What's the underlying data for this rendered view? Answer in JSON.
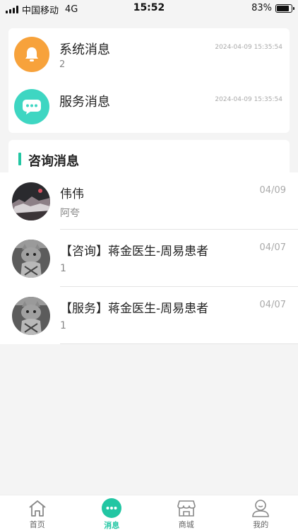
{
  "status_bar": {
    "carrier": "中国移动",
    "network": "4G",
    "time": "15:52",
    "battery": "83%",
    "battery_level": 0.83
  },
  "system_messages": [
    {
      "title": "系统消息",
      "count": "2",
      "time": "2024-04-09 15:35:54",
      "icon": "bell-icon",
      "color": "#f7a23b"
    },
    {
      "title": "服务消息",
      "count": "",
      "time": "2024-04-09 15:35:54",
      "icon": "chat-bubble-icon",
      "color": "#3ed6c2"
    }
  ],
  "consult": {
    "header": "咨询消息",
    "accent": "#22c6a3",
    "items": [
      {
        "name": "伟伟",
        "preview": "阿夸",
        "date": "04/09",
        "avatar": "landscape-avatar"
      },
      {
        "name": "【咨询】蒋金医生-周易患者",
        "preview": "1",
        "date": "04/07",
        "avatar": "cat-avatar"
      },
      {
        "name": "【服务】蒋金医生-周易患者",
        "preview": "1",
        "date": "04/07",
        "avatar": "cat-avatar"
      }
    ]
  },
  "tab_bar": {
    "tabs": [
      {
        "label": "首页",
        "icon": "home-icon",
        "active": false
      },
      {
        "label": "消息",
        "icon": "message-icon",
        "active": true
      },
      {
        "label": "商城",
        "icon": "shop-icon",
        "active": false
      },
      {
        "label": "我的",
        "icon": "profile-icon",
        "active": false
      }
    ],
    "active_color": "#22c6a3"
  }
}
